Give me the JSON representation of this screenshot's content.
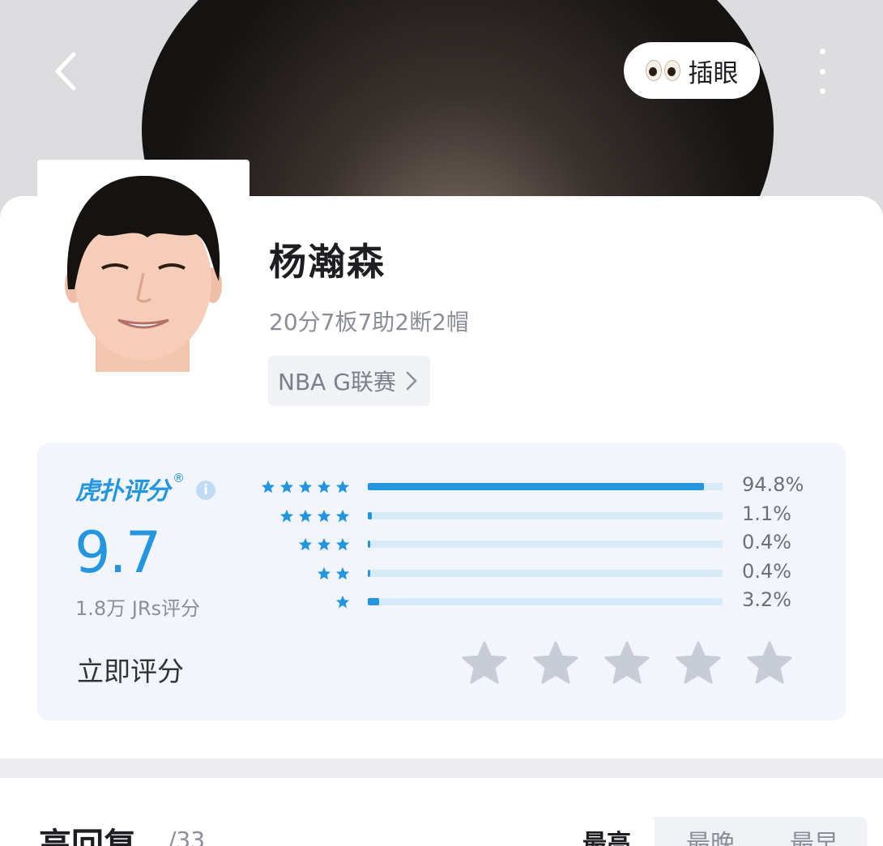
{
  "header": {
    "back_icon": "chevron-left-icon",
    "eyes_icon": "eyes-emoji-icon",
    "eyes_label": "插眼",
    "more_icon": "more-vertical-icon"
  },
  "player": {
    "name": "杨瀚森",
    "stats": "20分7板7助2断2帽",
    "league": "NBA G联赛",
    "league_icon": "chevron-right-icon"
  },
  "rating": {
    "brand": "虎扑评分",
    "brand_mark": "®",
    "info_icon": "info-icon",
    "score": "9.7",
    "raters": "1.8万 JRs评分",
    "rate_now": "立即评分",
    "accent_color": "#2496e0",
    "distribution": [
      {
        "stars": 5,
        "percent": 94.8,
        "label": "94.8%"
      },
      {
        "stars": 4,
        "percent": 1.1,
        "label": "1.1%"
      },
      {
        "stars": 3,
        "percent": 0.4,
        "label": "0.4%"
      },
      {
        "stars": 2,
        "percent": 0.4,
        "label": "0.4%"
      },
      {
        "stars": 1,
        "percent": 3.2,
        "label": "3.2%"
      }
    ],
    "input_stars": 5,
    "input_star_color": "#c7ccd6"
  },
  "comments": {
    "title": "高回复",
    "count": "/33",
    "sort_tabs": [
      "最高",
      "最晚",
      "最早"
    ]
  }
}
